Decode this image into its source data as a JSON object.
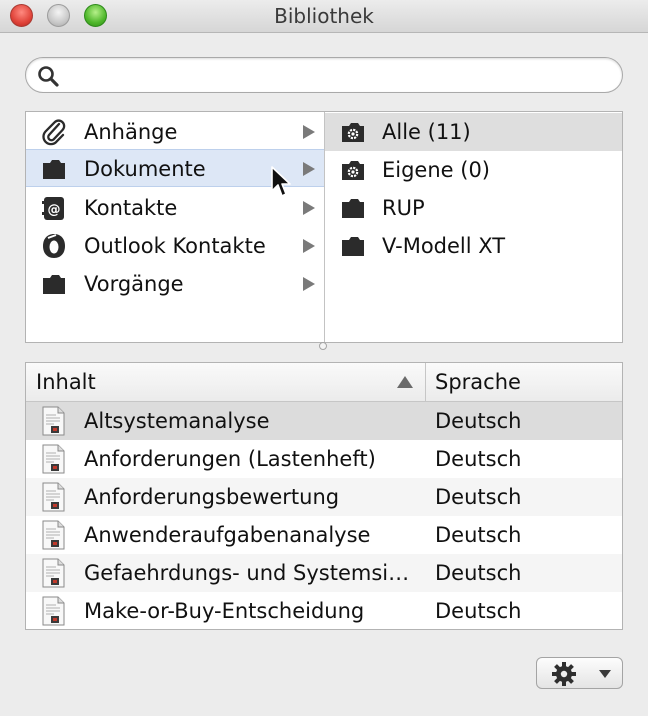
{
  "window": {
    "title": "Bibliothek"
  },
  "search": {
    "value": "",
    "placeholder": ""
  },
  "browser": {
    "left_items": [
      {
        "label": "Anhänge",
        "icon": "paperclip-icon"
      },
      {
        "label": "Dokumente",
        "icon": "folder-icon",
        "selected": true
      },
      {
        "label": "Kontakte",
        "icon": "address-book-icon"
      },
      {
        "label": "Outlook Kontakte",
        "icon": "outlook-icon"
      },
      {
        "label": "Vorgänge",
        "icon": "folder-icon"
      }
    ],
    "right_items": [
      {
        "label": "Alle (11)",
        "icon": "smart-folder-icon",
        "selected": true
      },
      {
        "label": "Eigene (0)",
        "icon": "smart-folder-icon"
      },
      {
        "label": "RUP",
        "icon": "folder-icon"
      },
      {
        "label": "V-Modell XT",
        "icon": "folder-icon"
      }
    ]
  },
  "table": {
    "headers": {
      "content": "Inhalt",
      "language": "Sprache"
    },
    "rows": [
      {
        "name": "Altsystemanalyse",
        "language": "Deutsch"
      },
      {
        "name": "Anforderungen (Lastenheft)",
        "language": "Deutsch"
      },
      {
        "name": "Anforderungsbewertung",
        "language": "Deutsch"
      },
      {
        "name": "Anwenderaufgabenanalyse",
        "language": "Deutsch"
      },
      {
        "name": "Gefaehrdungs- und Systemsi…",
        "language": "Deutsch"
      },
      {
        "name": "Make-or-Buy-Entscheidung",
        "language": "Deutsch"
      }
    ]
  },
  "colors": {
    "selection": "#dde7f6",
    "row_selected": "#dcdcdc",
    "icon": "#2b2b2b"
  }
}
